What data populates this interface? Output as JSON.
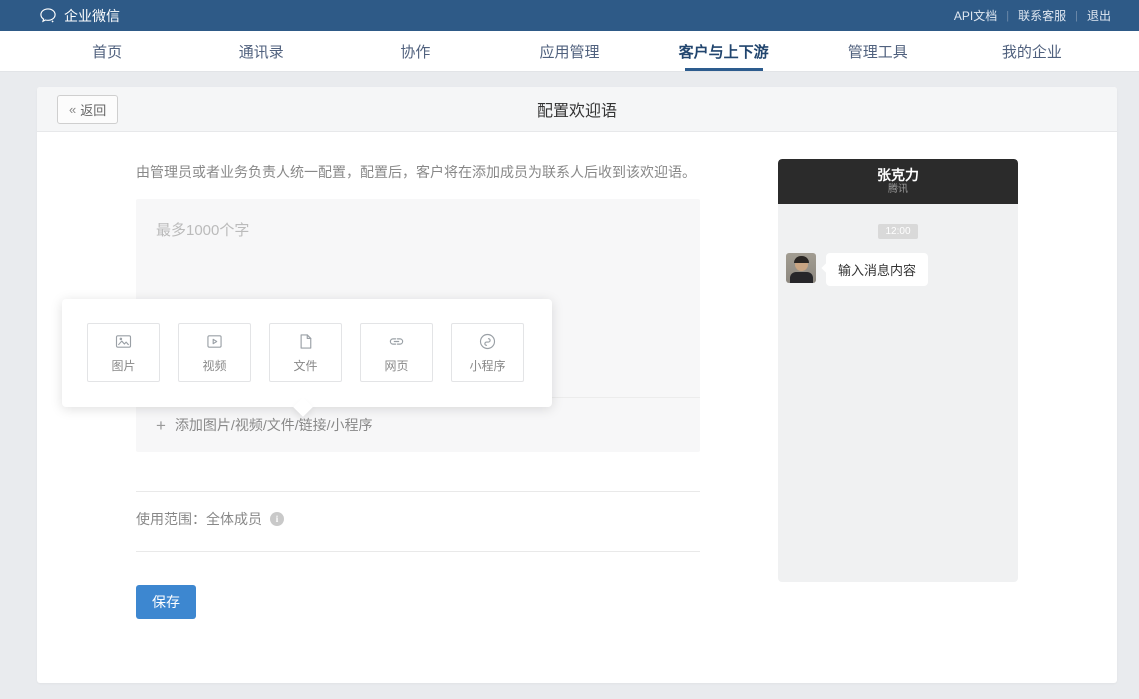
{
  "topbar": {
    "brand": "企业微信",
    "separator": "|",
    "links": [
      {
        "label": "API文档"
      },
      {
        "label": "联系客服"
      },
      {
        "label": "退出"
      }
    ]
  },
  "nav": {
    "tabs": [
      {
        "label": "首页",
        "active": false
      },
      {
        "label": "通讯录",
        "active": false
      },
      {
        "label": "协作",
        "active": false
      },
      {
        "label": "应用管理",
        "active": false
      },
      {
        "label": "客户与上下游",
        "active": true
      },
      {
        "label": "管理工具",
        "active": false
      },
      {
        "label": "我的企业",
        "active": false
      }
    ]
  },
  "page": {
    "back_chevron": "«",
    "back_label": "返回",
    "title": "配置欢迎语",
    "description": "由管理员或者业务负责人统一配置，配置后，客户将在添加成员为联系人后收到该欢迎语。",
    "editor": {
      "placeholder": "最多1000个字"
    },
    "attach_popup": {
      "items": [
        {
          "label": "图片",
          "icon": "image-icon"
        },
        {
          "label": "视频",
          "icon": "video-icon"
        },
        {
          "label": "文件",
          "icon": "file-icon"
        },
        {
          "label": "网页",
          "icon": "link-icon"
        },
        {
          "label": "小程序",
          "icon": "miniprogram-icon"
        }
      ]
    },
    "add_link": {
      "plus": "+",
      "label": "添加图片/视频/文件/链接/小程序"
    },
    "scope": {
      "label": "使用范围：",
      "value": "全体成员",
      "info_glyph": "i"
    },
    "save_label": "保存"
  },
  "preview": {
    "contact_name": "张克力",
    "contact_org": "腾讯",
    "timestamp": "12:00",
    "message_placeholder": "输入消息内容"
  },
  "colors": {
    "topbar_bg": "#2e5a87",
    "nav_active": "#2d5c8e",
    "save_button": "#3d87d0",
    "preview_header_bg": "#2b2b2b",
    "page_bg": "#e9ebee"
  }
}
